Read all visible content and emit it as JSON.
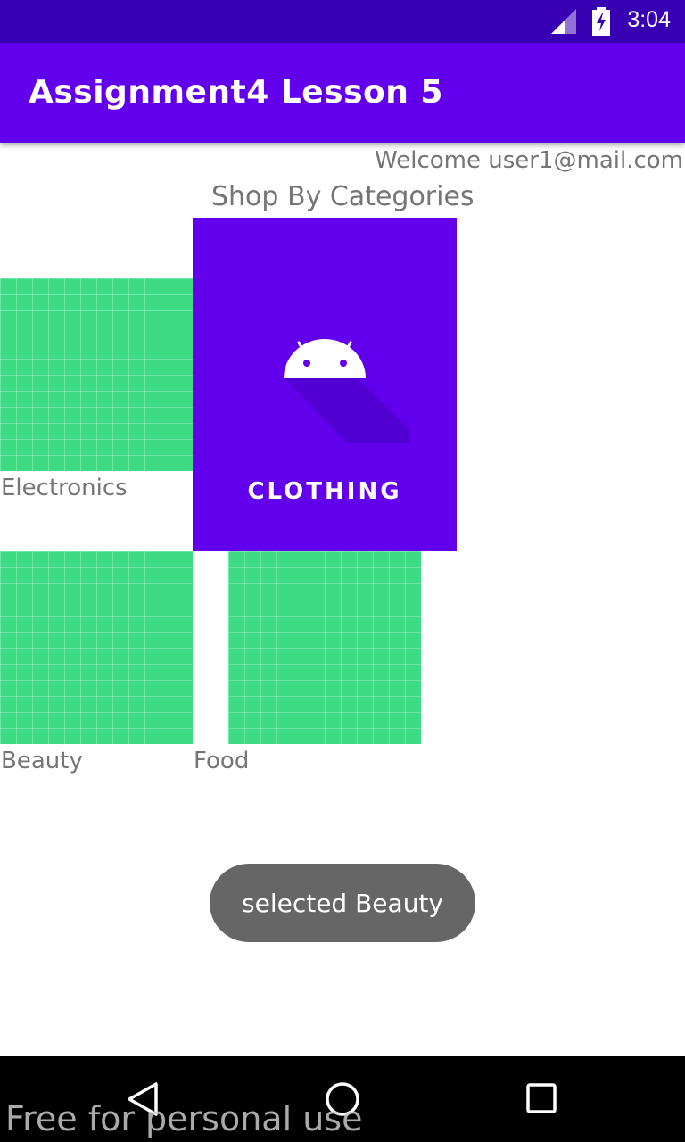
{
  "status_bar": {
    "time": "3:04"
  },
  "app_bar": {
    "title": "Assignment4 Lesson 5"
  },
  "welcome": "Welcome user1@mail.com",
  "heading": "Shop By Categories",
  "categories": {
    "electronics": "Electronics",
    "clothing": "CLOTHING",
    "beauty": "Beauty",
    "food": "Food"
  },
  "toast": "selected Beauty",
  "watermark": "Free for personal use",
  "colors": {
    "status_bar": "#3700b3",
    "app_bar": "#6200ee",
    "tile": "#3ddc84",
    "toast": "#666666"
  },
  "icons": [
    "signal-icon",
    "battery-charging-icon",
    "android-icon",
    "back-icon",
    "home-icon",
    "recents-icon"
  ]
}
